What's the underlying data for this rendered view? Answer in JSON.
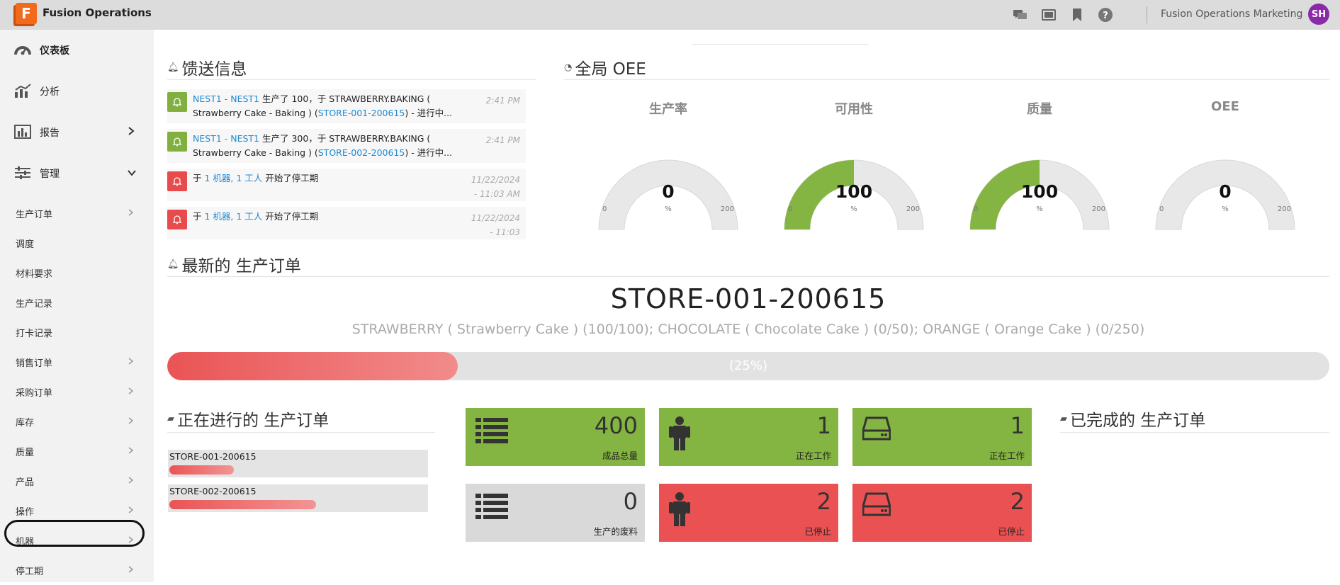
{
  "app": {
    "logo_letter": "F",
    "title": "Fusion Operations",
    "org": "Fusion Operations Marketing",
    "avatar": "SH"
  },
  "topbar_icons": [
    "chat-icon",
    "display-icon",
    "bookmark-icon",
    "help-icon"
  ],
  "sidebar": {
    "main": [
      {
        "label": "仪表板",
        "icon": "dashboard-icon",
        "bold": true
      },
      {
        "label": "分析",
        "icon": "analytics-icon"
      },
      {
        "label": "报告",
        "icon": "report-icon",
        "chevron": "›"
      },
      {
        "label": "管理",
        "icon": "settings-sliders-icon",
        "chevron": "⌄"
      }
    ],
    "sub": [
      {
        "label": "生产订单",
        "chevron": true
      },
      {
        "label": "调度",
        "chevron": false
      },
      {
        "label": "材料要求",
        "chevron": false
      },
      {
        "label": "生产记录",
        "chevron": false
      },
      {
        "label": "打卡记录",
        "chevron": false
      },
      {
        "label": "销售订单",
        "chevron": true
      },
      {
        "label": "采购订单",
        "chevron": true
      },
      {
        "label": "库存",
        "chevron": true
      },
      {
        "label": "质量",
        "chevron": true
      },
      {
        "label": "产品",
        "chevron": true
      },
      {
        "label": "操作",
        "chevron": true
      },
      {
        "label": "机器",
        "chevron": true
      },
      {
        "label": "停工期",
        "chevron": true
      }
    ]
  },
  "feed": {
    "title": "馈送信息",
    "items": [
      {
        "type": "green",
        "link": "NEST1 - NEST1",
        "text1": " 生产了 100，于 STRAWBERRY.BAKING ( Strawberry Cake - Baking ) (",
        "link2": "STORE-001-200615",
        "text2": ") - 进行中...",
        "time": "2:41 PM"
      },
      {
        "type": "green",
        "link": "NEST1 - NEST1",
        "text1": " 生产了 300，于 STRAWBERRY.BAKING ( Strawberry Cake - Baking ) (",
        "link2": "STORE-002-200615",
        "text2": ") - 进行中...",
        "time": "2:41 PM"
      },
      {
        "type": "red",
        "pre": "于 ",
        "link": "1 机器, 1 工人",
        "text1": " 开始了停工期",
        "link2": "",
        "text2": "",
        "time": "11/22/2024 - 11:03 AM"
      },
      {
        "type": "red",
        "pre": "于 ",
        "link": "1 机器, 1 工人",
        "text1": " 开始了停工期",
        "link2": "",
        "text2": "",
        "time": "11/22/2024 - 11:03"
      }
    ]
  },
  "oee": {
    "title": "全局 OEE",
    "gauges": [
      {
        "label": "生产率",
        "value": "0",
        "fraction": 0,
        "min": "0",
        "unit": "%",
        "max": "200"
      },
      {
        "label": "可用性",
        "value": "100",
        "fraction": 0.5,
        "min": "0",
        "unit": "%",
        "max": "200"
      },
      {
        "label": "质量",
        "value": "100",
        "fraction": 0.5,
        "min": "0",
        "unit": "%",
        "max": "200"
      },
      {
        "label": "OEE",
        "value": "0",
        "fraction": 0,
        "min": "0",
        "unit": "%",
        "max": "200"
      }
    ]
  },
  "latest": {
    "title": "最新的 生产订单",
    "code": "STORE-001-200615",
    "desc": "STRAWBERRY ( Strawberry Cake ) (100/100); CHOCOLATE ( Chocolate Cake ) (0/50); ORANGE ( Orange Cake ) (0/250)",
    "progress_pct": 25,
    "progress_label": "(25%)"
  },
  "in_progress": {
    "title": "正在进行的 生产订单",
    "items": [
      {
        "code": "STORE-001-200615",
        "progress": 0.25
      },
      {
        "code": "STORE-002-200615",
        "progress": 0.57
      }
    ]
  },
  "tiles": [
    {
      "value": "400",
      "caption": "成品总量",
      "color": "green",
      "icon": "list-icon"
    },
    {
      "value": "1",
      "caption": "正在工作",
      "color": "green",
      "icon": "worker-icon"
    },
    {
      "value": "1",
      "caption": "正在工作",
      "color": "green",
      "icon": "machine-icon"
    },
    {
      "value": "0",
      "caption": "生产的废料",
      "color": "grey",
      "icon": "list-icon"
    },
    {
      "value": "2",
      "caption": "已停止",
      "color": "red",
      "icon": "worker-icon"
    },
    {
      "value": "2",
      "caption": "已停止",
      "color": "red",
      "icon": "machine-icon"
    }
  ],
  "completed": {
    "title": "已完成的 生产订单"
  }
}
